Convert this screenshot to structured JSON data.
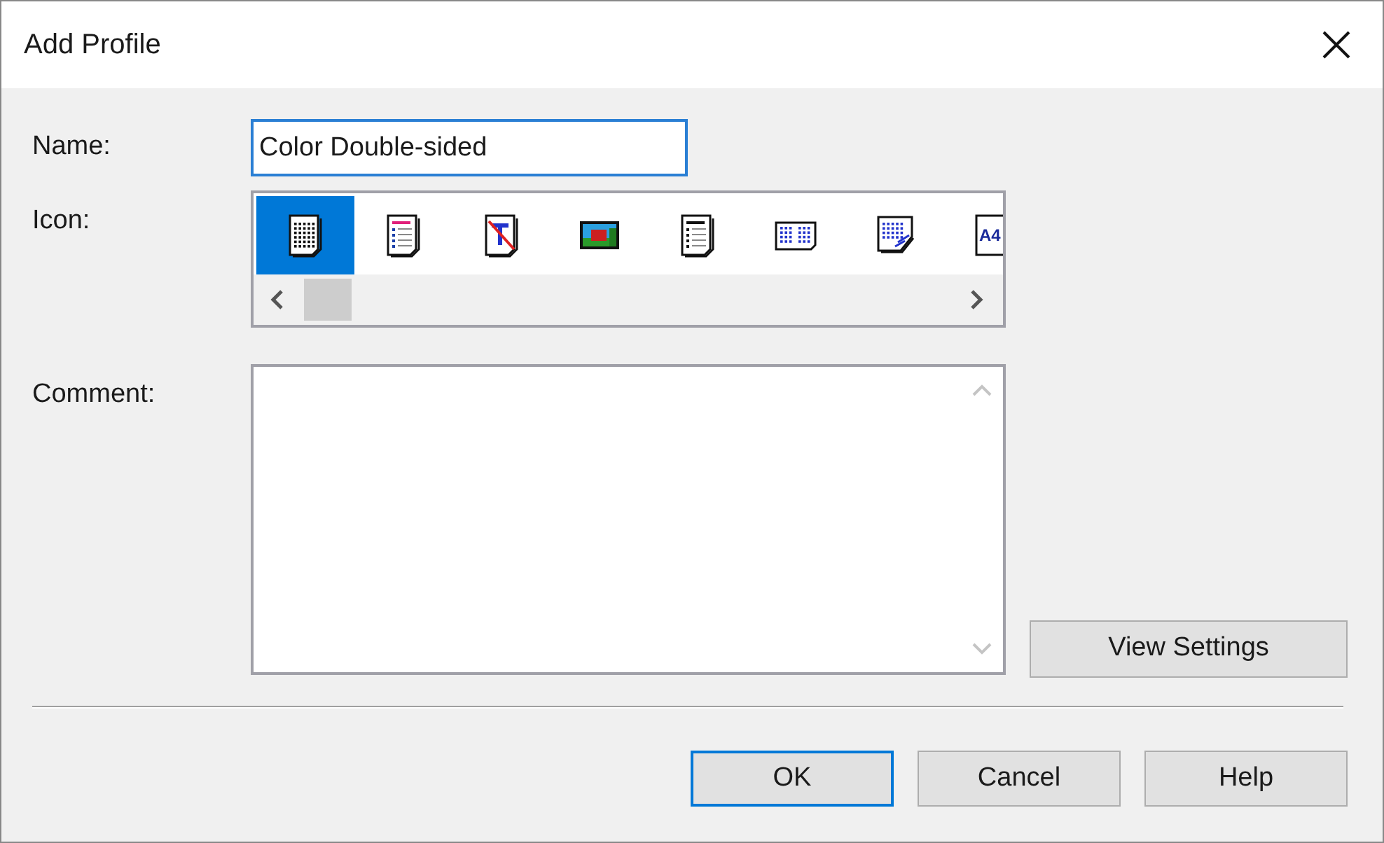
{
  "window": {
    "title": "Add Profile"
  },
  "name_field": {
    "label": "Name:",
    "value": "Color Double-sided"
  },
  "icon_list": {
    "label": "Icon:",
    "items": [
      {
        "kind": "grid-page",
        "selected": true
      },
      {
        "kind": "color-list",
        "selected": false
      },
      {
        "kind": "no-text",
        "selected": false
      },
      {
        "kind": "picture",
        "selected": false
      },
      {
        "kind": "list-page",
        "selected": false
      },
      {
        "kind": "two-grid",
        "selected": false
      },
      {
        "kind": "folded-grid",
        "selected": false
      },
      {
        "kind": "a4",
        "label": "A4",
        "selected": false
      }
    ]
  },
  "comment_field": {
    "label": "Comment:"
  },
  "view_settings_button": "View Settings",
  "buttons": [
    {
      "label": "OK",
      "default": true
    },
    {
      "label": "Cancel",
      "default": false
    },
    {
      "label": "Help",
      "default": false
    }
  ]
}
